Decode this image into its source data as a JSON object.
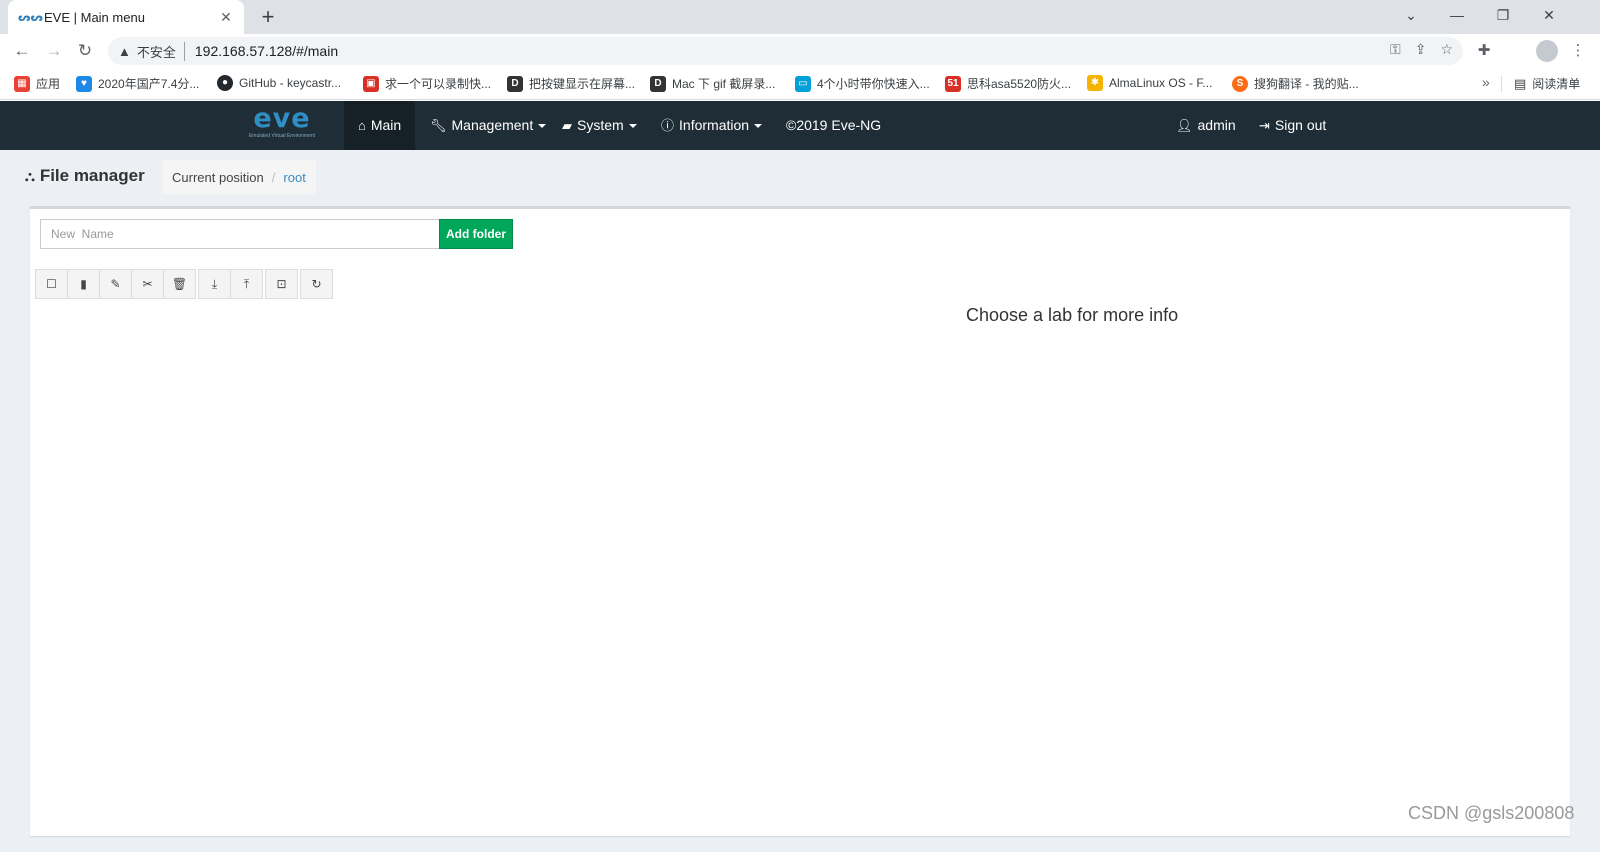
{
  "browser": {
    "tab_title": "EVE | Main menu",
    "tab_close": "✕",
    "new_tab": "+",
    "window_controls": [
      "⌄",
      "—",
      "❐",
      "✕"
    ],
    "nav": {
      "back": "←",
      "forward": "→",
      "reload": "↻"
    },
    "insecure_label": "不安全",
    "url": "192.168.57.128/#/main",
    "omnibox_icons": [
      "key-icon",
      "share-icon",
      "star-icon"
    ],
    "bookmarks": [
      {
        "label": "应用",
        "icon": "apps-icon",
        "color": "#e94235"
      },
      {
        "label": "2020年国产7.4分...",
        "icon": "heart-icon",
        "color": "#1e88e5"
      },
      {
        "label": "GitHub - keycastr...",
        "icon": "github-icon",
        "color": "#24292e"
      },
      {
        "label": "求一个可以录制快...",
        "icon": "image-icon",
        "color": "#d93025"
      },
      {
        "label": "把按键显示在屏幕...",
        "icon": "d-icon",
        "color": "#333333"
      },
      {
        "label": "Mac 下 gif 截屏录...",
        "icon": "d-icon",
        "color": "#333333"
      },
      {
        "label": "4个小时带你快速入...",
        "icon": "bilibili-icon",
        "color": "#00a1d6"
      },
      {
        "label": "思科asa5520防火...",
        "icon": "51-icon",
        "color": "#d93025"
      },
      {
        "label": "AlmaLinux OS - F...",
        "icon": "alma-icon",
        "color": "#f4b400"
      },
      {
        "label": "搜狗翻译 - 我的贴...",
        "icon": "sogou-icon",
        "color": "#fb6c14"
      }
    ],
    "bookmarks_more": "»",
    "reading_list": "阅读清单"
  },
  "eve": {
    "logo_word": "eve",
    "logo_sub": "Emulated Virtual Environment",
    "nav": {
      "main": "Main",
      "management": "Management",
      "system": "System",
      "information": "Information",
      "copyright": "©2019 Eve-NG",
      "admin": "admin",
      "signout": "Sign out"
    },
    "page_title": "File manager",
    "breadcrumb": {
      "label": "Current position",
      "separator": "/",
      "root": "root"
    },
    "new_name_placeholder": "New  Name",
    "add_folder": "Add folder",
    "choose_info": "Choose a lab for more info"
  },
  "watermark": "CSDN @gsls200808",
  "colors": {
    "navbar": "#1f2d36",
    "logo": "#2f8fc4",
    "add_folder": "#00a65a",
    "link": "#3c8dbc",
    "page_bg": "#ecf0f5"
  }
}
